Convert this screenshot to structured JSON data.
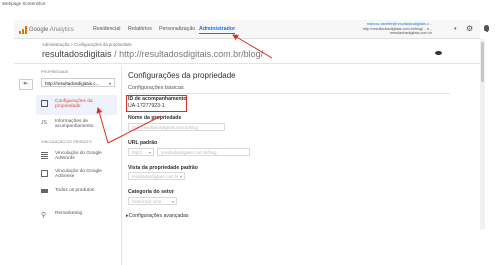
{
  "caption": "Webpage Screenshot",
  "topbar": {
    "logo_brand": "Google",
    "logo_product": "Analytics",
    "nav": [
      "Residencial",
      "Relatórios",
      "Personalização",
      "Administrador"
    ],
    "active_nav_index": 3,
    "account": {
      "email": "marcos.zanette@resultadosdigitais.c...",
      "property": "http://resultadosdigitais.com.br/blog/ - h...",
      "view": "resultadosdigitais.com.br"
    }
  },
  "header": {
    "breadcrumb": "Administração > Configurações da propriedade",
    "site_name": "resultadosdigitais",
    "site_url": "/ http://resultadosdigitais.com.br/blog/"
  },
  "sidebar": {
    "property_label": "PROPRIEDADE",
    "property_select": "http://resultadosdigitais.c...",
    "items": [
      {
        "label": "Configurações da propriedade",
        "icon": "page-icon"
      },
      {
        "label": "Informações de acompanhamento",
        "icon": "js-icon"
      }
    ],
    "product_links_label": "VINCULAÇÃO DO PRODUTO",
    "product_items": [
      {
        "label": "Vinculação do Google AdWords",
        "icon": "adwords-icon"
      },
      {
        "label": "Vinculação do Google AdSense",
        "icon": "adsense-icon"
      },
      {
        "label": "Todos os produtos",
        "icon": "products-icon"
      }
    ],
    "remarketing": {
      "label": "Remarketing",
      "icon": "remarketing-icon"
    }
  },
  "main": {
    "title": "Configurações da propriedade",
    "section": "Configurações básicas",
    "tracking_id_label": "ID de acompanhamento",
    "tracking_id_value": "UA-17277923-1",
    "property_name_label": "Nome da propriedade",
    "property_name_value": "http://resultadosdigitais.com.br/blog",
    "default_url_label": "URL padrão",
    "default_url_protocol": "http://",
    "default_url_value": "resultadosdigitais.com.br/blog",
    "default_view_label": "Vista da propriedade padrão",
    "default_view_value": "resultadosdigitais.com.br",
    "industry_label": "Categoria do setor",
    "industry_value": "Selecionar uma",
    "advanced_label": "Configurações avançadas"
  },
  "colors": {
    "accent": "#1a73e8",
    "highlight": "#d93025",
    "selected_text": "#dd4b39"
  }
}
